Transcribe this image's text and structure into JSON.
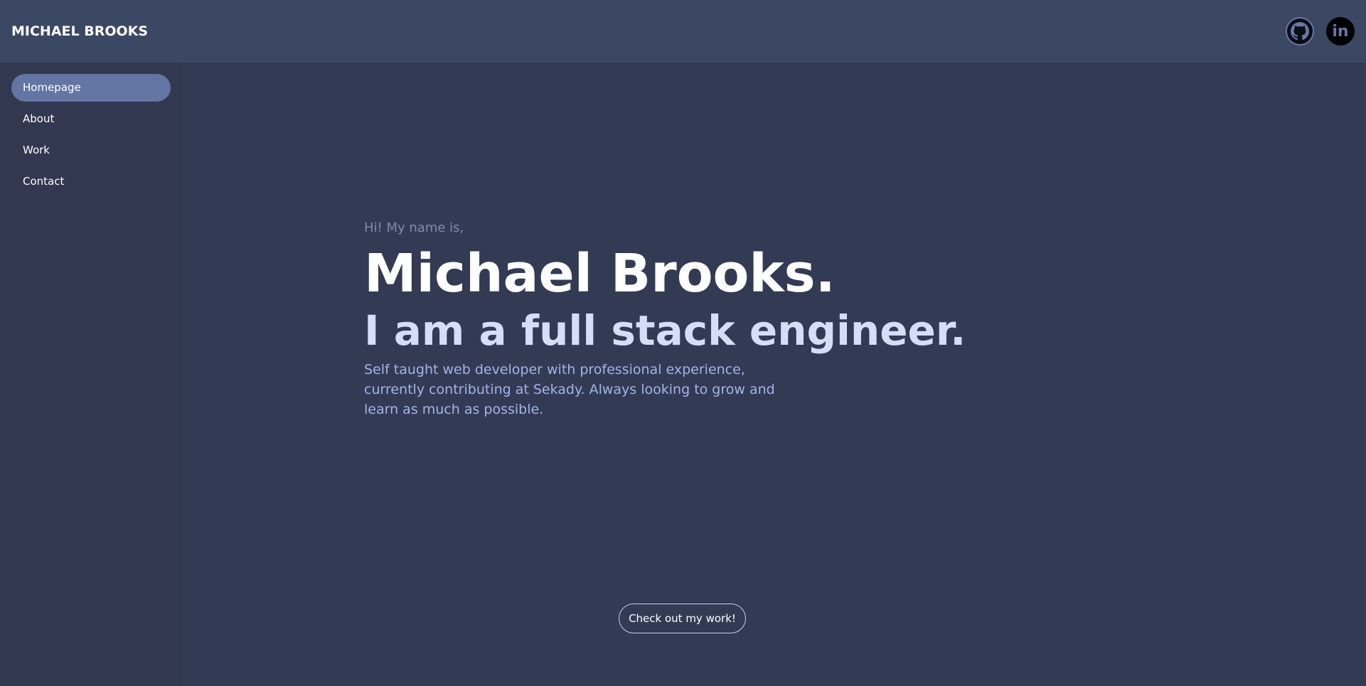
{
  "header": {
    "brand": "MICHAEL BROOKS",
    "icons": [
      "github-icon",
      "linkedin-icon"
    ],
    "linkedin_text": "in"
  },
  "sidebar": {
    "items": [
      {
        "label": "Homepage",
        "active": true
      },
      {
        "label": "About"
      },
      {
        "label": "Work"
      },
      {
        "label": "Contact"
      }
    ]
  },
  "hero": {
    "greeting": "Hi! My name is,",
    "name": "Michael Brooks.",
    "role": "I am a full stack engineer.",
    "description": "Self taught web developer with professional experience, currently contributing at Sekady. Always looking to grow and learn as much as possible.",
    "cta": "Check out my work!"
  },
  "colors": {
    "header": "#3c4764",
    "background": "#333b54",
    "accent": "#6375a3"
  }
}
